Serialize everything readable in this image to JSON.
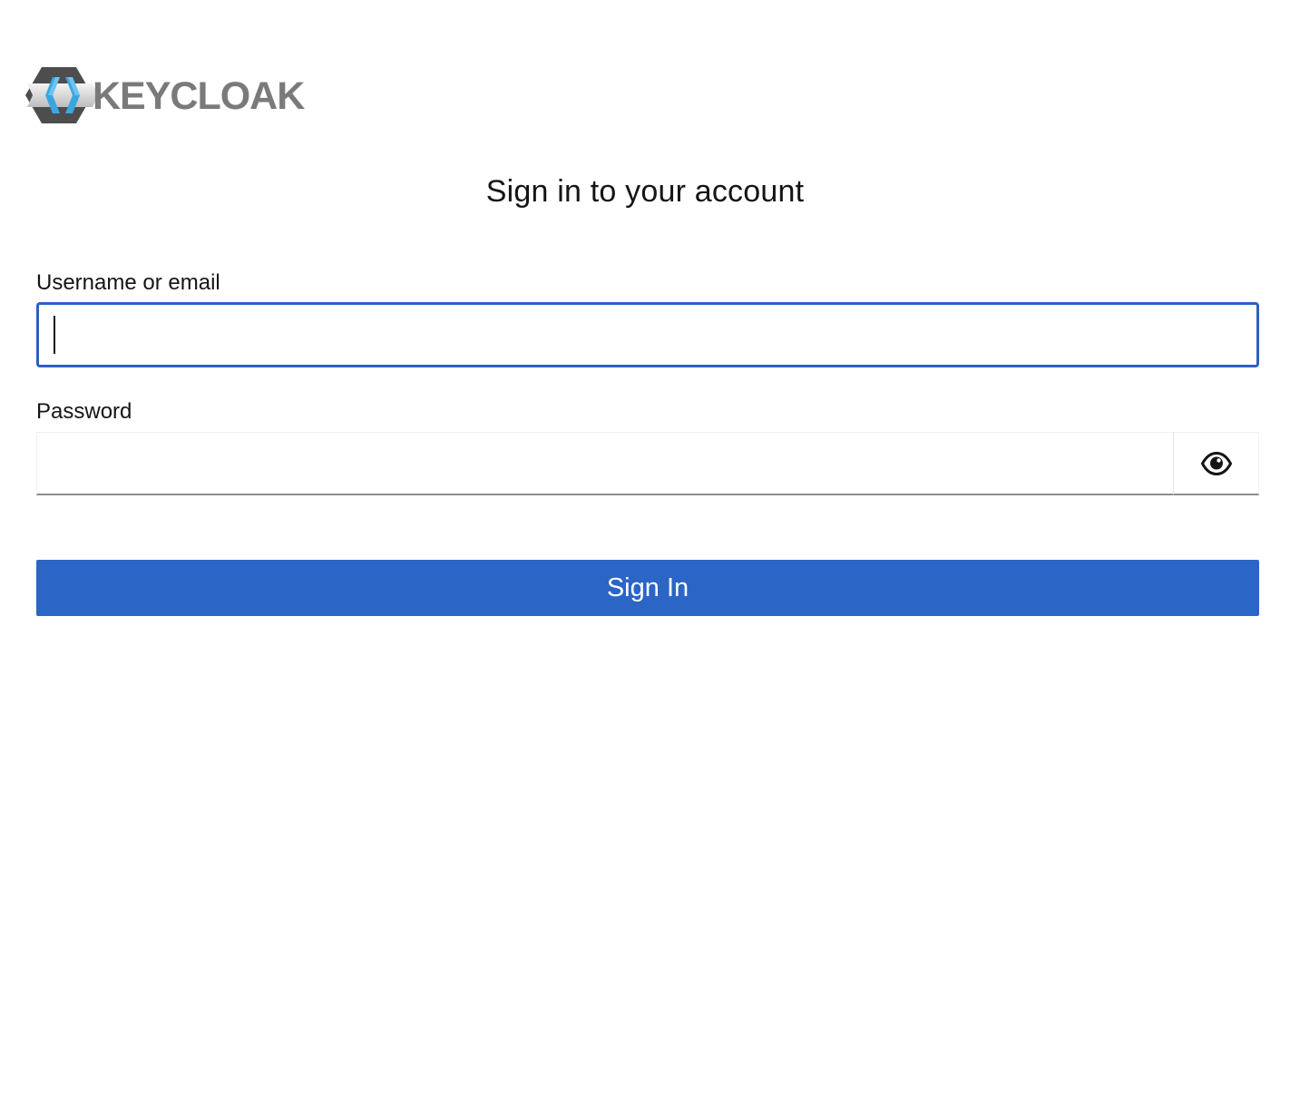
{
  "logo": {
    "text": "KEYCLOAK",
    "icon": "keycloak-logo-icon"
  },
  "form": {
    "title": "Sign in to your account",
    "username": {
      "label": "Username or email",
      "value": ""
    },
    "password": {
      "label": "Password",
      "value": "",
      "toggle_icon": "eye-icon"
    },
    "submit_label": "Sign In"
  },
  "colors": {
    "primary": "#2b65c6",
    "focus_border": "#2b61c2",
    "text": "#151515",
    "logo_text": "#7a7a7a"
  }
}
